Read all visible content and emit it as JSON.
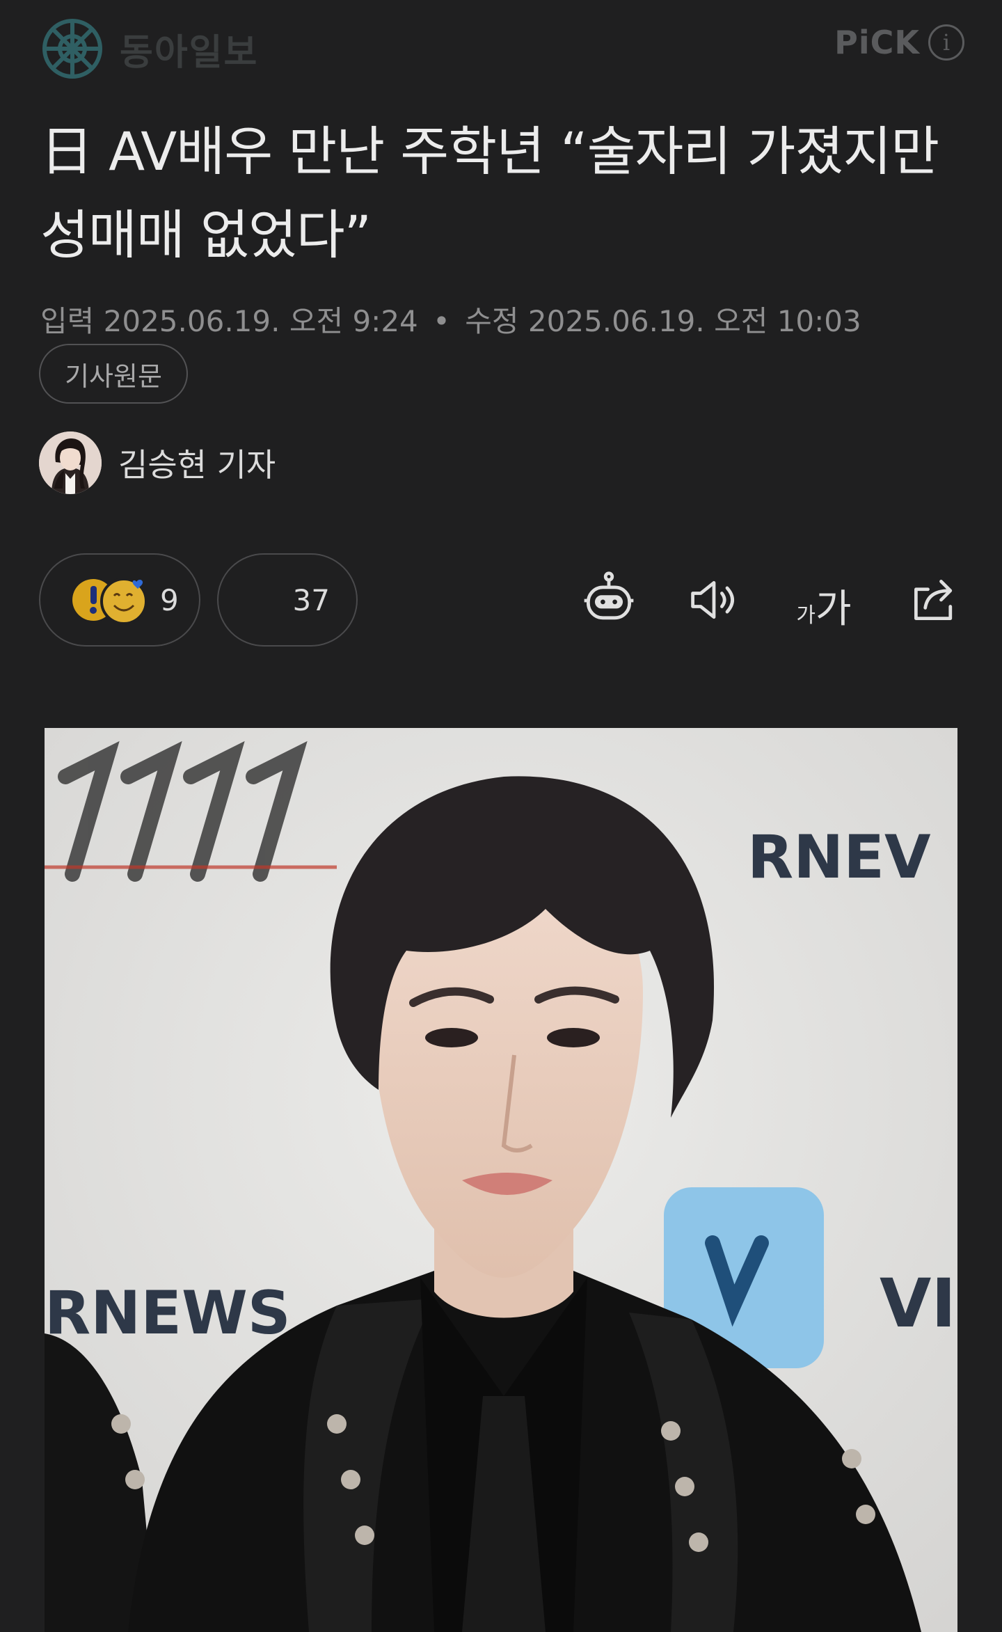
{
  "header": {
    "logo_text": "동아일보",
    "pick_text": "PiCK",
    "info_icon": "i"
  },
  "article": {
    "headline": "日 AV배우 만난 주학년 “술자리 가졌지만 성매매 없었다”",
    "input_label": "입력",
    "input_date": "2025.06.19. 오전 9:24",
    "separator": "•",
    "modified_label": "수정",
    "modified_date": "2025.06.19. 오전 10:03",
    "original_button": "기사원문",
    "author": "김승현 기자"
  },
  "reactions": {
    "emotion_count": "9",
    "comment_count": "37"
  },
  "toolbar": {
    "icons": [
      "robot-summary-icon",
      "speaker-icon",
      "font-size-icon",
      "share-icon"
    ],
    "font_small": "가",
    "font_large": "가"
  },
  "photo": {
    "backdrop_text_1": "RNEV",
    "backdrop_text_2": "RNEWS",
    "backdrop_text_3": "VI"
  },
  "colors": {
    "background": "#1f1f20",
    "logo_accent": "#2f5f63",
    "text_primary": "#ececec",
    "text_secondary": "#8f8f90"
  }
}
